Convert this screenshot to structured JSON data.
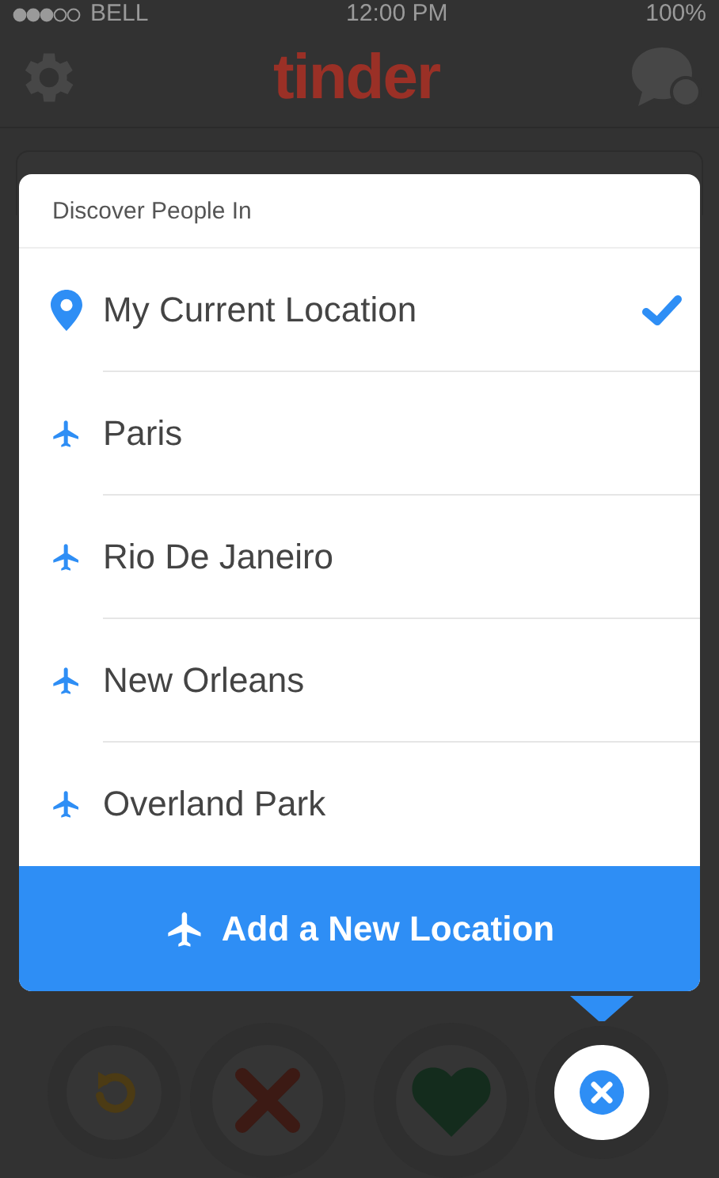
{
  "status_bar": {
    "carrier": "BELL",
    "time": "12:00 PM",
    "battery": "100%"
  },
  "nav": {
    "logo": "tinder"
  },
  "popup": {
    "title": "Discover People In",
    "locations": [
      {
        "name": "My Current Location",
        "kind": "current",
        "selected": true
      },
      {
        "name": "Paris",
        "kind": "travel",
        "selected": false
      },
      {
        "name": "Rio De Janeiro",
        "kind": "travel",
        "selected": false
      },
      {
        "name": "New Orleans",
        "kind": "travel",
        "selected": false
      },
      {
        "name": "Overland Park",
        "kind": "travel",
        "selected": false
      }
    ],
    "add_button": "Add a New Location"
  }
}
